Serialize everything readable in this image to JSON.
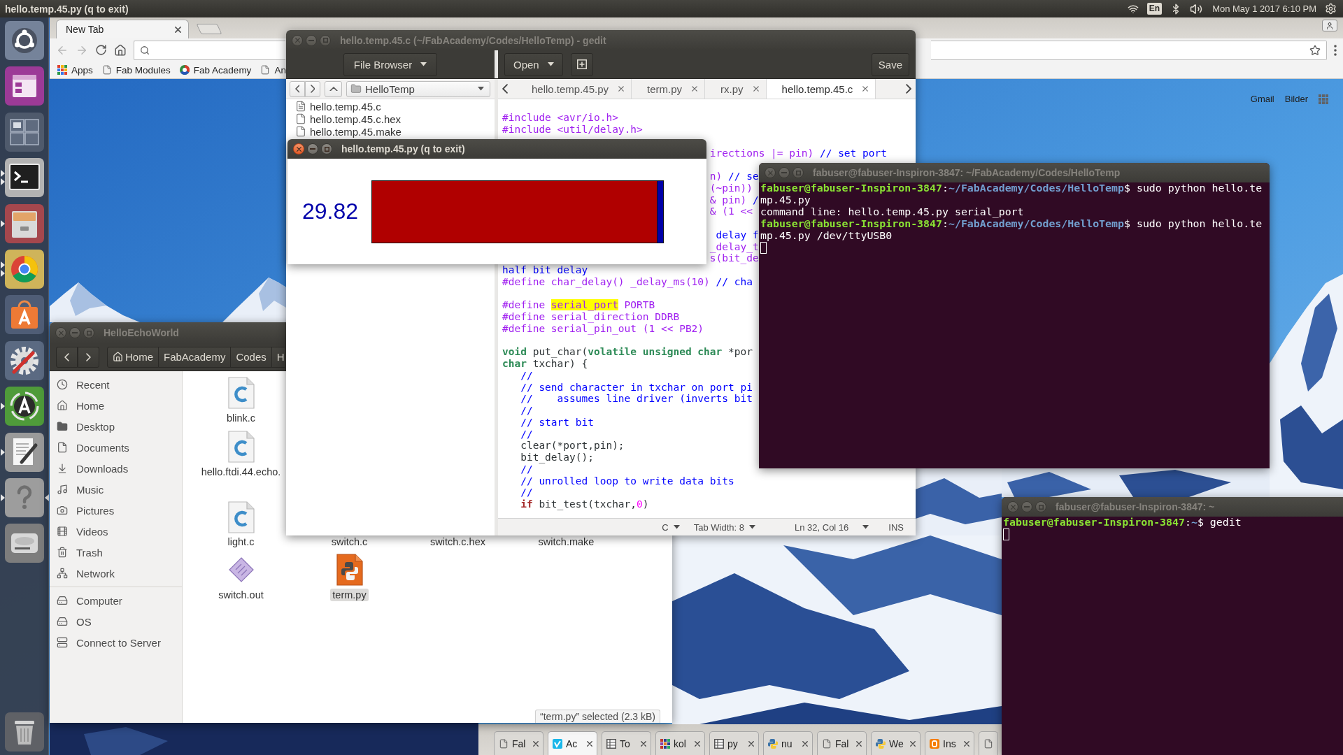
{
  "top_panel": {
    "title": "hello.temp.45.py (q to exit)",
    "keyboard": "En",
    "clock": "Mon May 1 2017 6:10 PM"
  },
  "launcher": [
    {
      "kind": "dash",
      "running": false,
      "focused": false
    },
    {
      "kind": "window-app",
      "running": false,
      "focused": false
    },
    {
      "kind": "workspaces",
      "running": false,
      "focused": false
    },
    {
      "kind": "terminal",
      "running": true,
      "multiple_windows": true,
      "focused": false
    },
    {
      "kind": "files",
      "running": true,
      "multiple_windows": false,
      "focused": false
    },
    {
      "kind": "browser",
      "running": true,
      "multiple_windows": true,
      "focused": false
    },
    {
      "kind": "software",
      "running": false,
      "focused": false
    },
    {
      "kind": "settings",
      "running": false,
      "focused": false
    },
    {
      "kind": "updater",
      "running": true,
      "multiple_windows": false,
      "focused": false
    },
    {
      "kind": "editor",
      "running": true,
      "multiple_windows": false,
      "focused": false
    },
    {
      "kind": "help",
      "running": true,
      "multiple_windows": false,
      "focused": true
    },
    {
      "kind": "drive",
      "running": false,
      "focused": false
    },
    {
      "kind": "trash",
      "running": false,
      "focused": false
    }
  ],
  "browser": {
    "tabs": [
      {
        "label": "New Tab",
        "selected": true
      }
    ],
    "back": {
      "disabled": true
    },
    "forward": {
      "disabled": true
    },
    "bookmarks": [
      {
        "label": "Apps",
        "kind": "apps"
      },
      {
        "label": "Fab Modules",
        "kind": "page"
      },
      {
        "label": "Fab Academy",
        "kind": "logo"
      },
      {
        "label": "An",
        "kind": "page"
      }
    ],
    "links": [
      "Gmail",
      "Bilder"
    ]
  },
  "gedit": {
    "title": "hello.temp.45.c (~/FabAcademy/Codes/HelloTemp) - gedit",
    "active": false,
    "panel_button": "File Browser",
    "open_button": "Open",
    "save_button": "Save",
    "folder": "HelloTemp",
    "files": [
      {
        "name": "hello.temp.45.c",
        "kind": "text"
      },
      {
        "name": "hello.temp.45.c.hex",
        "kind": "plain"
      },
      {
        "name": "hello.temp.45.make",
        "kind": "plain"
      }
    ],
    "tabs": [
      {
        "label": "hello.temp.45.py",
        "selected": false
      },
      {
        "label": "term.py",
        "selected": false
      },
      {
        "label": "rx.py",
        "selected": false
      },
      {
        "label": "hello.temp.45.c",
        "selected": true
      }
    ],
    "code_lines": [
      {
        "kind": "blank"
      },
      {
        "kind": "code",
        "segments": [
          {
            "kind": "preproc",
            "text": "#include <avr/io.h>"
          }
        ]
      },
      {
        "kind": "code",
        "segments": [
          {
            "kind": "preproc",
            "text": "#include <util/delay.h>"
          }
        ]
      },
      {
        "kind": "blank"
      },
      {
        "kind": "code",
        "segments": [
          {
            "kind": "preproc",
            "text": "                                  irections |= pin) "
          },
          {
            "kind": "comment",
            "text": "// set port"
          }
        ]
      },
      {
        "kind": "blank"
      },
      {
        "kind": "code",
        "segments": [
          {
            "kind": "preproc",
            "text": "                                  n) "
          },
          {
            "kind": "comment",
            "text": "// se"
          }
        ]
      },
      {
        "kind": "code",
        "segments": [
          {
            "kind": "preproc",
            "text": "                                  (~pin))"
          }
        ]
      },
      {
        "kind": "code",
        "segments": [
          {
            "kind": "preproc",
            "text": "                                  & pin) "
          },
          {
            "kind": "comment",
            "text": "/"
          }
        ]
      },
      {
        "kind": "code",
        "segments": [
          {
            "kind": "preproc",
            "text": "                                  & (1 <<"
          }
        ]
      },
      {
        "kind": "blank"
      },
      {
        "kind": "code",
        "segments": [
          {
            "kind": "comment",
            "text": "                                   delay f"
          }
        ]
      },
      {
        "kind": "code",
        "segments": [
          {
            "kind": "preproc",
            "text": "                                  _delay_t"
          }
        ]
      },
      {
        "kind": "code",
        "segments": [
          {
            "kind": "preproc",
            "text": "                                  s(bit_de"
          }
        ]
      },
      {
        "kind": "code",
        "segments": [
          {
            "kind": "comment",
            "text": "half bit delay"
          }
        ]
      },
      {
        "kind": "code",
        "segments": [
          {
            "kind": "preproc",
            "text": "#define char_delay() _delay_ms(10) "
          },
          {
            "kind": "comment",
            "text": "// cha"
          }
        ]
      },
      {
        "kind": "blank"
      },
      {
        "kind": "code",
        "segments": [
          {
            "kind": "preproc",
            "text": "#define "
          },
          {
            "kind": "match",
            "text": "serial_port"
          },
          {
            "kind": "preproc",
            "text": " PORTB"
          }
        ]
      },
      {
        "kind": "code",
        "segments": [
          {
            "kind": "preproc",
            "text": "#define serial_direction DDRB"
          }
        ]
      },
      {
        "kind": "code",
        "segments": [
          {
            "kind": "preproc",
            "text": "#define serial_pin_out (1 << PB2)"
          }
        ]
      },
      {
        "kind": "blank"
      },
      {
        "kind": "code",
        "segments": [
          {
            "kind": "type",
            "text": "void"
          },
          {
            "kind": "plain",
            "text": " put_char("
          },
          {
            "kind": "type",
            "text": "volatile unsigned char"
          },
          {
            "kind": "plain",
            "text": " *por"
          }
        ]
      },
      {
        "kind": "code",
        "segments": [
          {
            "kind": "type",
            "text": "char"
          },
          {
            "kind": "plain",
            "text": " txchar) {"
          }
        ]
      },
      {
        "kind": "code",
        "segments": [
          {
            "kind": "comment",
            "text": "   //"
          }
        ]
      },
      {
        "kind": "code",
        "segments": [
          {
            "kind": "comment",
            "text": "   // send character in txchar on port pi"
          }
        ]
      },
      {
        "kind": "code",
        "segments": [
          {
            "kind": "comment",
            "text": "   //    assumes line driver (inverts bit"
          }
        ]
      },
      {
        "kind": "code",
        "segments": [
          {
            "kind": "comment",
            "text": "   //"
          }
        ]
      },
      {
        "kind": "code",
        "segments": [
          {
            "kind": "comment",
            "text": "   // start bit"
          }
        ]
      },
      {
        "kind": "code",
        "segments": [
          {
            "kind": "comment",
            "text": "   //"
          }
        ]
      },
      {
        "kind": "code",
        "segments": [
          {
            "kind": "plain",
            "text": "   clear(*port,pin);"
          }
        ]
      },
      {
        "kind": "code",
        "segments": [
          {
            "kind": "plain",
            "text": "   bit_delay();"
          }
        ]
      },
      {
        "kind": "code",
        "segments": [
          {
            "kind": "comment",
            "text": "   //"
          }
        ]
      },
      {
        "kind": "code",
        "segments": [
          {
            "kind": "comment",
            "text": "   // unrolled loop to write data bits"
          }
        ]
      },
      {
        "kind": "code",
        "segments": [
          {
            "kind": "comment",
            "text": "   //"
          }
        ]
      },
      {
        "kind": "code",
        "segments": [
          {
            "kind": "keyword",
            "text": "   if"
          },
          {
            "kind": "plain",
            "text": " bit_test(txchar,"
          },
          {
            "kind": "number",
            "text": "0"
          },
          {
            "kind": "plain",
            "text": ")"
          }
        ]
      }
    ],
    "status": {
      "language": "C",
      "tab_width": "Tab Width: 8",
      "position": "Ln 32, Col 16",
      "mode": "INS"
    }
  },
  "python_window": {
    "title": "hello.temp.45.py (q to exit)",
    "active": true,
    "reading": "29.82",
    "level": 0.98
  },
  "file_manager": {
    "title": "HelloEchoWorld",
    "active": false,
    "path": [
      {
        "label": "Home",
        "kind": "home"
      },
      {
        "label": "FabAcademy",
        "kind": "plain"
      },
      {
        "label": "Codes",
        "kind": "plain"
      },
      {
        "label": "H",
        "kind": "plain"
      }
    ],
    "places": [
      {
        "label": "Recent",
        "kind": "recent",
        "selected": false
      },
      {
        "label": "Home",
        "kind": "home",
        "selected": false
      },
      {
        "label": "Desktop",
        "kind": "desktop",
        "selected": false
      },
      {
        "label": "Documents",
        "kind": "documents",
        "selected": false
      },
      {
        "label": "Downloads",
        "kind": "downloads",
        "selected": false
      },
      {
        "label": "Music",
        "kind": "music",
        "selected": false
      },
      {
        "label": "Pictures",
        "kind": "pictures",
        "selected": false
      },
      {
        "label": "Videos",
        "kind": "videos",
        "selected": false
      },
      {
        "label": "Trash",
        "kind": "trash",
        "selected": false
      },
      {
        "label": "Network",
        "kind": "network",
        "selected": false
      }
    ],
    "devices": [
      {
        "label": "Computer",
        "kind": "computer",
        "selected": false
      },
      {
        "label": "OS",
        "kind": "drive",
        "selected": false
      },
      {
        "label": "Connect to Server",
        "kind": "server",
        "selected": false
      }
    ],
    "files": [
      {
        "name": "blink.c",
        "kind": "c",
        "selected": false
      },
      {
        "name": "hello.ftdi.44.echo.",
        "kind": "c",
        "selected": false
      },
      {
        "name": "light.c",
        "kind": "c",
        "selected": false
      },
      {
        "name": "switch.c",
        "selected": false
      },
      {
        "name": "switch.c.hex",
        "selected": false
      },
      {
        "name": "switch.make",
        "selected": false
      },
      {
        "name": "switch.out",
        "kind": "binary",
        "selected": false
      },
      {
        "name": "term.py",
        "kind": "python",
        "selected": true
      }
    ],
    "status": "“term.py” selected (2.3 kB)"
  },
  "terminals": [
    {
      "title": "fabuser@fabuser-Inspiron-3847: ~/FabAcademy/Codes/HelloTemp",
      "active": false,
      "cursor": true,
      "lines": [
        {
          "segments": [
            {
              "kind": "user",
              "text": "fabuser@fabuser-Inspiron-3847"
            },
            {
              "kind": "plain",
              "text": ":"
            },
            {
              "kind": "path",
              "text": "~/FabAcademy/Codes/HelloTemp"
            },
            {
              "kind": "plain",
              "text": "$ sudo python hello.te"
            }
          ]
        },
        {
          "segments": [
            {
              "kind": "plain",
              "text": "mp.45.py"
            }
          ]
        },
        {
          "segments": [
            {
              "kind": "plain",
              "text": "command line: hello.temp.45.py serial_port"
            }
          ]
        },
        {
          "segments": [
            {
              "kind": "user",
              "text": "fabuser@fabuser-Inspiron-3847"
            },
            {
              "kind": "plain",
              "text": ":"
            },
            {
              "kind": "path",
              "text": "~/FabAcademy/Codes/HelloTemp"
            },
            {
              "kind": "plain",
              "text": "$ sudo python hello.te"
            }
          ]
        },
        {
          "segments": [
            {
              "kind": "plain",
              "text": "mp.45.py /dev/ttyUSB0"
            }
          ]
        }
      ]
    },
    {
      "title": "fabuser@fabuser-Inspiron-3847: ~",
      "active": false,
      "cursor": true,
      "lines": [
        {
          "segments": [
            {
              "kind": "user",
              "text": "fabuser@fabuser-Inspiron-3847"
            },
            {
              "kind": "plain",
              "text": ":"
            },
            {
              "kind": "path",
              "text": "~"
            },
            {
              "kind": "plain",
              "text": "$ gedit"
            }
          ]
        }
      ]
    }
  ],
  "browser_2_tabs": [
    {
      "label": "Fal",
      "kind": "page",
      "selected": false
    },
    {
      "label": "Ac",
      "kind": "v-logo",
      "selected": true
    },
    {
      "label": "To",
      "kind": "table",
      "selected": false
    },
    {
      "label": "kol",
      "kind": "dot-grid",
      "selected": false
    },
    {
      "label": "py",
      "kind": "table",
      "selected": false
    },
    {
      "label": "nu",
      "kind": "snakes",
      "selected": false
    },
    {
      "label": "Fal",
      "kind": "page",
      "selected": false
    },
    {
      "label": "We",
      "kind": "snakes",
      "selected": false
    },
    {
      "label": "Ins",
      "kind": "square-logo",
      "selected": false
    },
    {
      "kind": "page",
      "selected": false
    }
  ]
}
